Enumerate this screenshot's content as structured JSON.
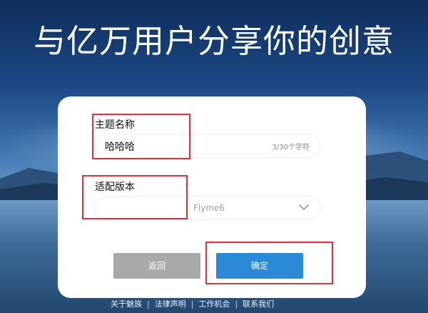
{
  "hero": {
    "title": "与亿万用户分享你的创意"
  },
  "form": {
    "theme_name": {
      "label": "主题名称",
      "value": "哈哈哈",
      "counter": "3/30个字符"
    },
    "version": {
      "label": "适配版本",
      "selected": "Flyme6"
    },
    "buttons": {
      "back": "返回",
      "confirm": "确定"
    }
  },
  "footer": {
    "links": [
      "关于魅族",
      "法律声明",
      "工作机会",
      "联系我们"
    ]
  },
  "colors": {
    "primary": "#2b8ad8",
    "secondary": "#a9a9a9",
    "highlight": "#e0313b"
  },
  "icons": {
    "select": "chevron-down-icon"
  }
}
